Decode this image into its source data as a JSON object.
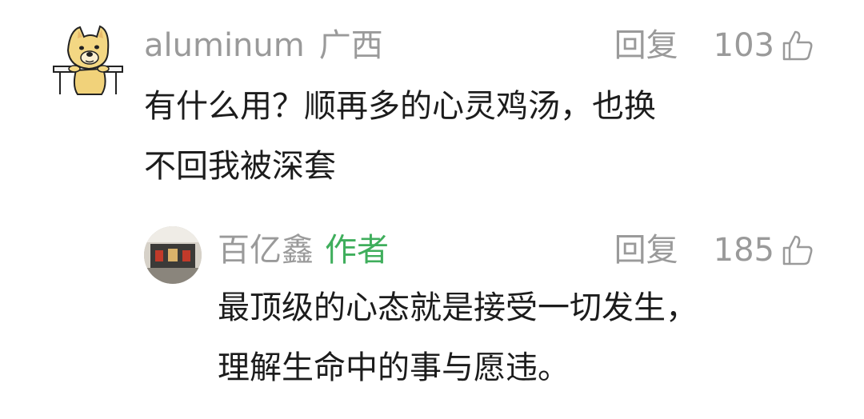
{
  "comment": {
    "username": "aluminum",
    "location": "广西",
    "reply_label": "回复",
    "likes": "103",
    "text": "有什么用？顺再多的心灵鸡汤，也换\n不回我被深套",
    "avatar_icon": "doge-avatar-icon",
    "like_icon": "thumbs-up-icon"
  },
  "reply": {
    "username": "百亿鑫",
    "author_tag": "作者",
    "reply_label": "回复",
    "likes": "185",
    "text": "最顶级的心态就是接受一切发生，\n理解生命中的事与愿违。",
    "avatar_icon": "author-avatar-icon",
    "like_icon": "thumbs-up-icon"
  },
  "colors": {
    "meta_gray": "#9a9a9a",
    "author_green": "#3fae5c",
    "text": "#1c1c1c"
  }
}
